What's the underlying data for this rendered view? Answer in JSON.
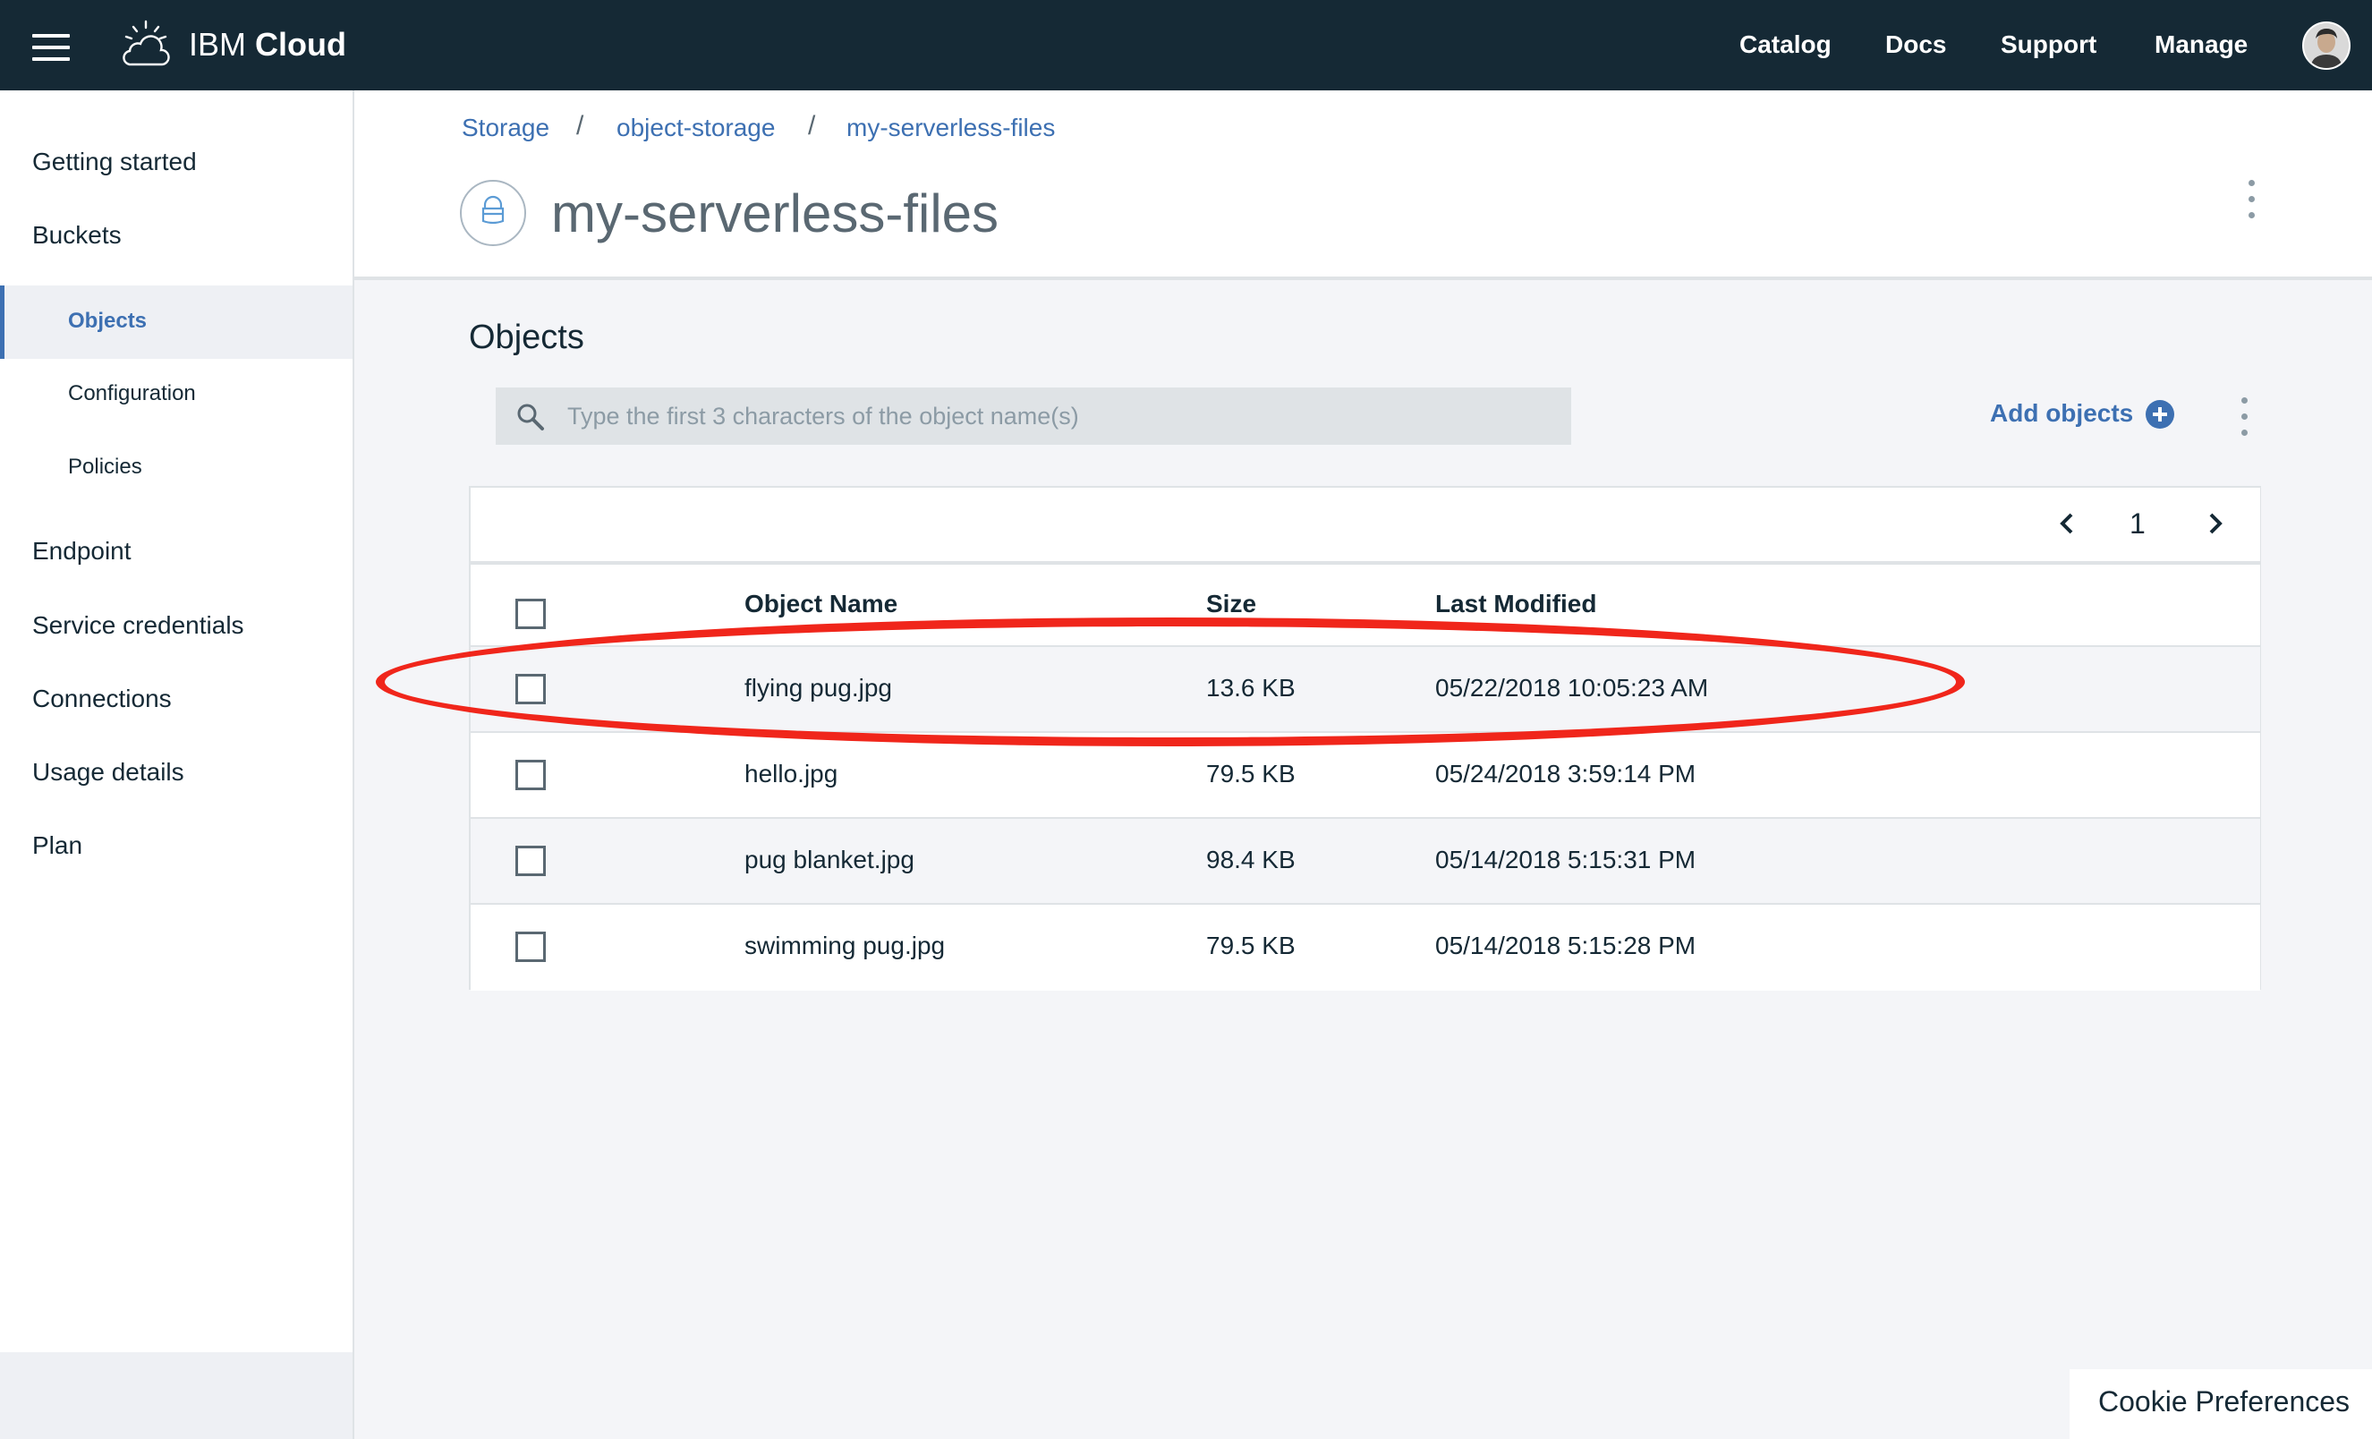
{
  "topbar": {
    "brand_prefix": "IBM",
    "brand_name": "Cloud",
    "nav": [
      "Catalog",
      "Docs",
      "Support",
      "Manage"
    ]
  },
  "sidebar": {
    "items": [
      "Getting started",
      "Buckets"
    ],
    "sub_items": [
      "Objects",
      "Configuration",
      "Policies"
    ],
    "items_after": [
      "Endpoint",
      "Service credentials",
      "Connections",
      "Usage details",
      "Plan"
    ]
  },
  "breadcrumb": [
    "Storage",
    "object-storage",
    "my-serverless-files"
  ],
  "breadcrumb_separator": "/",
  "page_title": "my-serverless-files",
  "section_title": "Objects",
  "search": {
    "placeholder": "Type the first 3 characters of the object name(s)"
  },
  "add_objects_label": "Add objects",
  "pager": {
    "current_page": "1"
  },
  "table": {
    "columns": [
      "Object Name",
      "Size",
      "Last Modified"
    ],
    "rows": [
      {
        "name": "flying pug.jpg",
        "size": "13.6 KB",
        "modified": "05/22/2018 10:05:23 AM"
      },
      {
        "name": "hello.jpg",
        "size": "79.5 KB",
        "modified": "05/24/2018 3:59:14 PM"
      },
      {
        "name": "pug blanket.jpg",
        "size": "98.4 KB",
        "modified": "05/14/2018 5:15:31 PM"
      },
      {
        "name": "swimming pug.jpg",
        "size": "79.5 KB",
        "modified": "05/14/2018 5:15:28 PM"
      }
    ]
  },
  "cookie_label": "Cookie Preferences",
  "colors": {
    "topbar": "#152935",
    "link": "#3d70b2",
    "highlight": "#f0261b"
  }
}
